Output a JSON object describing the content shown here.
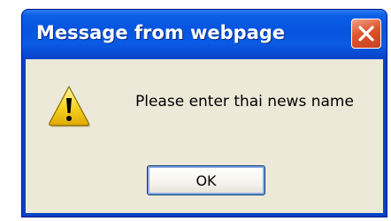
{
  "dialog": {
    "title": "Message from webpage",
    "message": "Please enter thai news name",
    "ok_label": "OK",
    "icons": {
      "close": "close-icon",
      "warning": "warning-icon"
    }
  }
}
